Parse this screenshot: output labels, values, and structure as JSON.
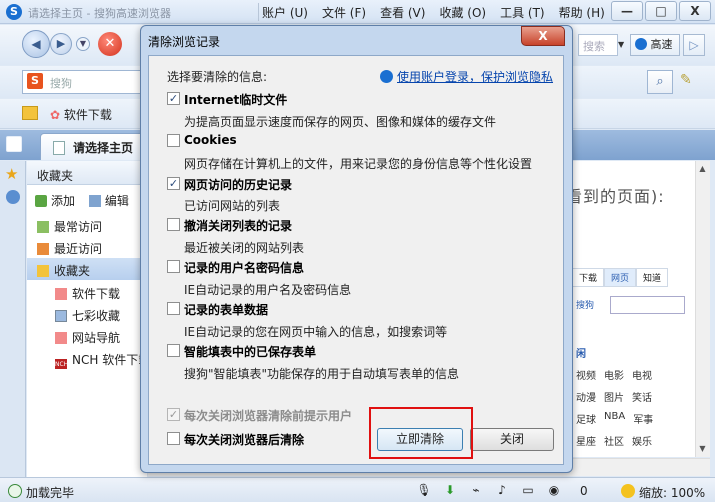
{
  "browser": {
    "window_title": "请选择主页 - 搜狗高速浏览器",
    "menu": [
      "账户 (U)",
      "文件 (F)",
      "查看 (V)",
      "收藏 (O)",
      "工具 (T)",
      "帮助 (H)"
    ],
    "window_buttons": {
      "minimize": "—",
      "maximize": "□",
      "close": "X"
    },
    "search_placeholder": "搜索",
    "gaosu_label": "高速",
    "address_placeholder": "搜狗",
    "fav_bar": {
      "software_download": "软件下载"
    },
    "tab": {
      "label": "请选择主页"
    },
    "status": {
      "text": "加载完毕",
      "counter": "0",
      "zoom": "缩放: 100%"
    }
  },
  "side_panel": {
    "title": "收藏夹",
    "add_label": "添加",
    "edit_label": "编辑",
    "items": [
      {
        "label": "最常访问"
      },
      {
        "label": "最近访问"
      },
      {
        "label": "收藏夹"
      },
      {
        "label": "软件下载"
      },
      {
        "label": "七彩收藏"
      },
      {
        "label": "网站导航"
      },
      {
        "label": "NCH 软件下载"
      }
    ]
  },
  "content_bg": {
    "big_text": "看到的页面):",
    "tabs": [
      "下载",
      "网页",
      "知道"
    ],
    "sogou": "搜狗",
    "section": "闲",
    "grid": [
      [
        "视频",
        "电影",
        "电视"
      ],
      [
        "动漫",
        "图片",
        "笑话"
      ],
      [
        "足球",
        "NBA",
        "军事"
      ],
      [
        "星座",
        "社区",
        "娱乐"
      ]
    ]
  },
  "dialog": {
    "title": "清除浏览记录",
    "close": "X",
    "prompt": "选择要清除的信息:",
    "privacy_link": "使用账户登录，保护浏览隐私",
    "options": [
      {
        "label": "Internet临时文件",
        "desc": "为提高页面显示速度而保存的网页、图像和媒体的缓存文件",
        "checked": true,
        "check_mark": "✓"
      },
      {
        "label": "Cookies",
        "desc": "网页存储在计算机上的文件，用来记录您的身份信息等个性化设置",
        "checked": false,
        "check_mark": ""
      },
      {
        "label": "网页访问的历史记录",
        "desc": "已访问网站的列表",
        "checked": true,
        "check_mark": "✓"
      },
      {
        "label": "撤消关闭列表的记录",
        "desc": "最近被关闭的网站列表",
        "checked": false,
        "check_mark": ""
      },
      {
        "label": "记录的用户名密码信息",
        "desc": "IE自动记录的用户名及密码信息",
        "checked": false,
        "check_mark": ""
      },
      {
        "label": "记录的表单数据",
        "desc": "IE自动记录的您在网页中输入的信息，如搜索词等",
        "checked": false,
        "check_mark": ""
      },
      {
        "label": "智能填表中的已保存表单",
        "desc": "搜狗\"智能填表\"功能保存的用于自动填写表单的信息",
        "checked": false,
        "check_mark": ""
      }
    ],
    "prompt_before_clear": {
      "label": "每次关闭浏览器清除前提示用户",
      "checked": true,
      "disabled": true,
      "check_mark": "✓"
    },
    "clear_on_close": {
      "label": "每次关闭浏览器后清除",
      "checked": false,
      "check_mark": ""
    },
    "clear_button": "立即清除",
    "close_button": "关闭"
  },
  "colors": {
    "highlight": "#e01010",
    "link": "#0645ad"
  }
}
